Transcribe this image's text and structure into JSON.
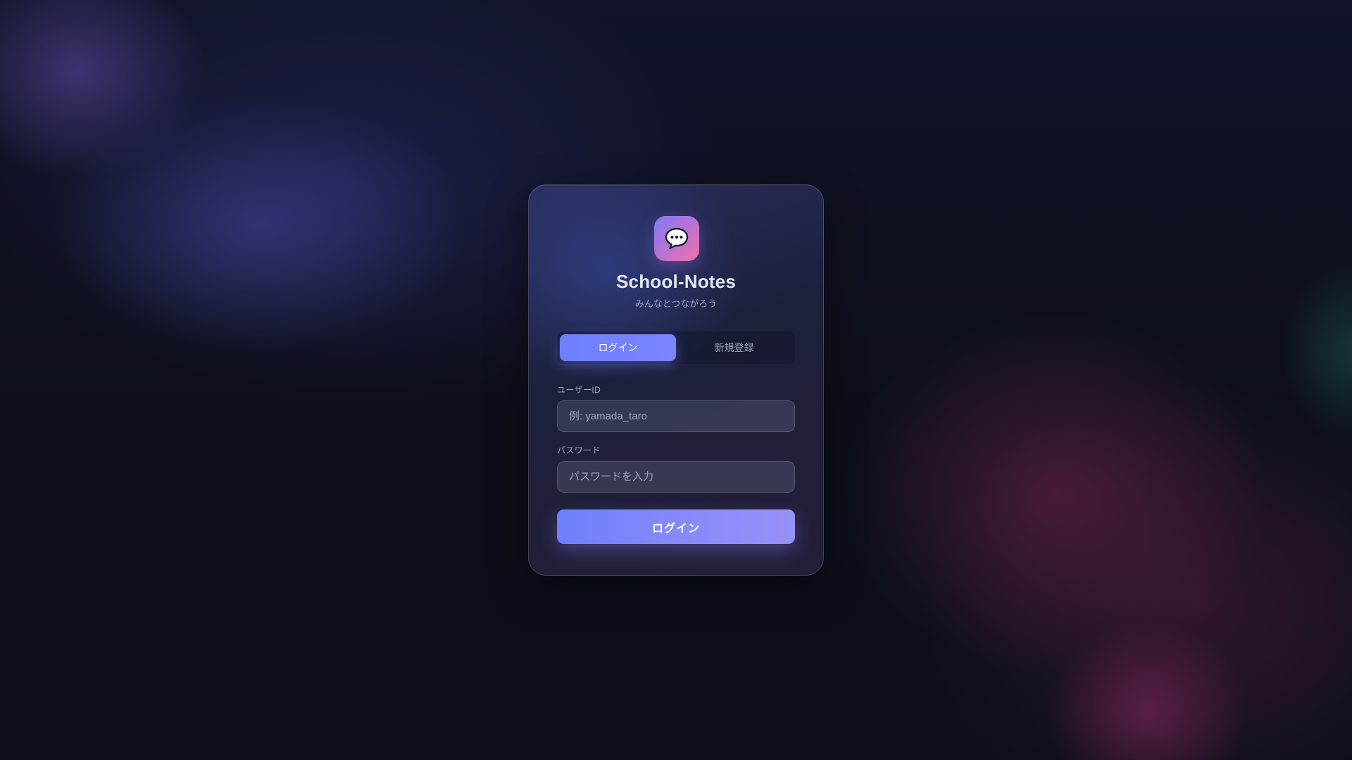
{
  "app": {
    "title": "School-Notes",
    "subtitle": "みんなとつながろう",
    "logo_icon": "speech-bubble-icon"
  },
  "tabs": [
    {
      "label": "ログイン",
      "active": true
    },
    {
      "label": "新規登録",
      "active": false
    }
  ],
  "form": {
    "user_id": {
      "label": "ユーザーID",
      "placeholder": "例: yamada_taro",
      "value": ""
    },
    "password": {
      "label": "パスワード",
      "placeholder": "パスワードを入力",
      "value": ""
    },
    "submit_label": "ログイン"
  },
  "colors": {
    "accent": "#6f80ff",
    "logo_gradient_start": "#7e7cf2",
    "logo_gradient_end": "#ee74a8",
    "background": "#0c0f18"
  }
}
